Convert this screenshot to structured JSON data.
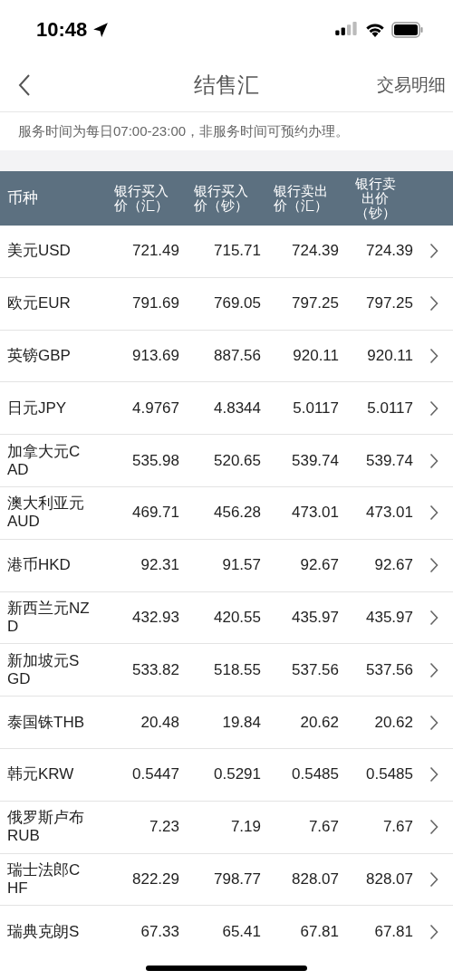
{
  "status_bar": {
    "time": "10:48"
  },
  "nav": {
    "title": "结售汇",
    "action": "交易明细"
  },
  "notice": "服务时间为每日07:00-23:00，非服务时间可预约办理。",
  "table": {
    "columns": [
      "币种",
      "银行买入价（汇）",
      "银行买入价（钞）",
      "银行卖出价（汇）",
      "银行卖出价（钞）"
    ],
    "rows": [
      {
        "currency": "美元USD",
        "values": [
          "721.49",
          "715.71",
          "724.39",
          "724.39"
        ]
      },
      {
        "currency": "欧元EUR",
        "values": [
          "791.69",
          "769.05",
          "797.25",
          "797.25"
        ]
      },
      {
        "currency": "英镑GBP",
        "values": [
          "913.69",
          "887.56",
          "920.11",
          "920.11"
        ]
      },
      {
        "currency": "日元JPY",
        "values": [
          "4.9767",
          "4.8344",
          "5.0117",
          "5.0117"
        ]
      },
      {
        "currency": "加拿大元CAD",
        "values": [
          "535.98",
          "520.65",
          "539.74",
          "539.74"
        ]
      },
      {
        "currency": "澳大利亚元AUD",
        "values": [
          "469.71",
          "456.28",
          "473.01",
          "473.01"
        ]
      },
      {
        "currency": "港币HKD",
        "values": [
          "92.31",
          "91.57",
          "92.67",
          "92.67"
        ]
      },
      {
        "currency": "新西兰元NZD",
        "values": [
          "432.93",
          "420.55",
          "435.97",
          "435.97"
        ]
      },
      {
        "currency": "新加坡元SGD",
        "values": [
          "533.82",
          "518.55",
          "537.56",
          "537.56"
        ]
      },
      {
        "currency": "泰国铢THB",
        "values": [
          "20.48",
          "19.84",
          "20.62",
          "20.62"
        ]
      },
      {
        "currency": "韩元KRW",
        "values": [
          "0.5447",
          "0.5291",
          "0.5485",
          "0.5485"
        ]
      },
      {
        "currency": "俄罗斯卢布RUB",
        "values": [
          "7.23",
          "7.19",
          "7.67",
          "7.67"
        ]
      },
      {
        "currency": "瑞士法郎CHF",
        "values": [
          "822.29",
          "798.77",
          "828.07",
          "828.07"
        ]
      },
      {
        "currency": "瑞典克朗S",
        "values": [
          "67.33",
          "65.41",
          "67.81",
          "67.81"
        ]
      }
    ]
  }
}
